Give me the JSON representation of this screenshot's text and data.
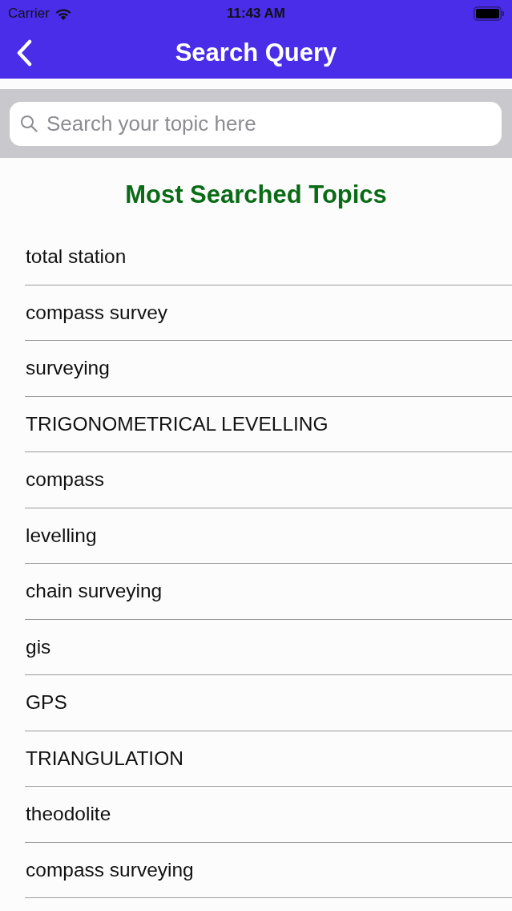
{
  "status_bar": {
    "carrier": "Carrier",
    "time": "11:43 AM"
  },
  "nav_bar": {
    "title": "Search Query"
  },
  "search": {
    "placeholder": "Search your topic here"
  },
  "section": {
    "title": "Most Searched Topics"
  },
  "topics": [
    "total station",
    "compass survey",
    "surveying",
    "TRIGONOMETRICAL LEVELLING",
    "compass",
    "levelling",
    "chain surveying",
    "gis",
    "GPS",
    "TRIANGULATION",
    "theodolite",
    "compass surveying"
  ]
}
